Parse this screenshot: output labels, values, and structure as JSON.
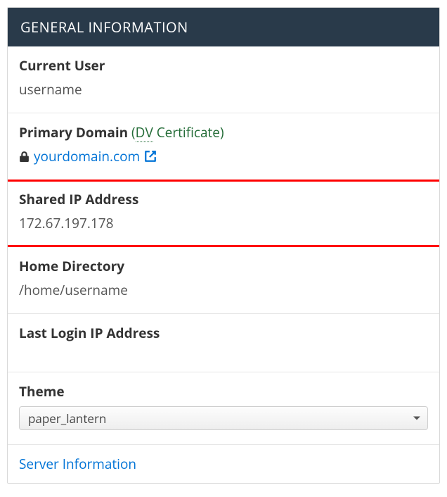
{
  "panel_title": "GENERAL INFORMATION",
  "rows": {
    "current_user": {
      "label": "Current User",
      "value": "username"
    },
    "primary_domain": {
      "label": "Primary Domain",
      "cert_prefix": "(",
      "cert_abbr": "DV",
      "cert_rest": " Certificate)",
      "domain": "yourdomain.com"
    },
    "shared_ip": {
      "label": "Shared IP Address",
      "value": "172.67.197.178"
    },
    "home_dir": {
      "label": "Home Directory",
      "value": "/home/username"
    },
    "last_login": {
      "label": "Last Login IP Address",
      "value": ""
    },
    "theme": {
      "label": "Theme",
      "selected": "paper_lantern"
    }
  },
  "footer_link": "Server Information"
}
